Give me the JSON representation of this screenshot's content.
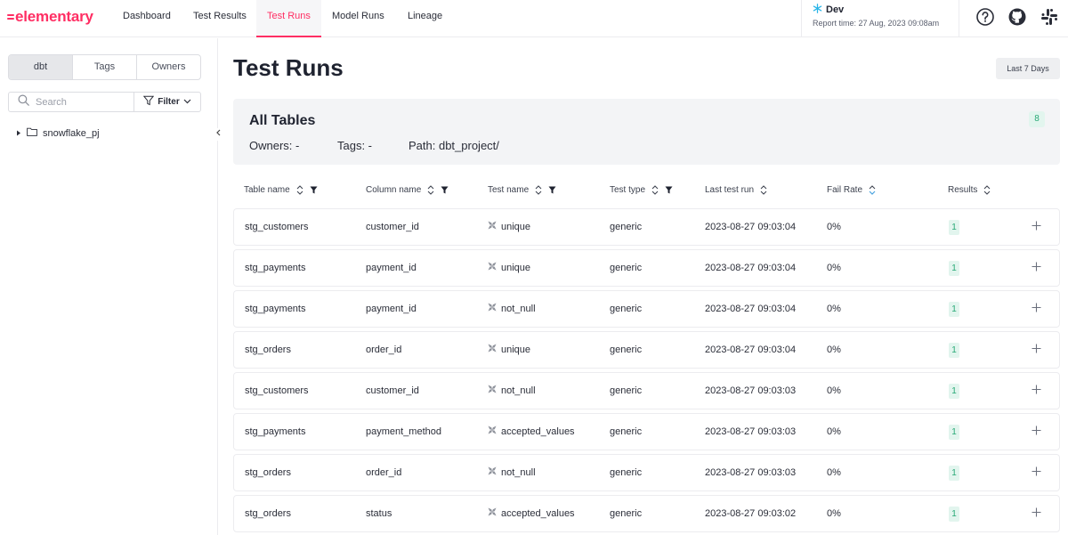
{
  "brand": {
    "name": "elementary",
    "color": "#ff2e63"
  },
  "nav": {
    "tabs": [
      {
        "label": "Dashboard"
      },
      {
        "label": "Test Results"
      },
      {
        "label": "Test Runs",
        "active": true
      },
      {
        "label": "Model Runs"
      },
      {
        "label": "Lineage"
      }
    ]
  },
  "env": {
    "icon": "snowflake-icon",
    "name": "Dev",
    "report_time": "Report time: 27 Aug, 2023 09:08am"
  },
  "header_icons": [
    "help-icon",
    "github-icon",
    "slack-icon"
  ],
  "sidebar": {
    "segments": [
      {
        "label": "dbt",
        "active": true
      },
      {
        "label": "Tags"
      },
      {
        "label": "Owners"
      }
    ],
    "search_placeholder": "Search",
    "filter_label": "Filter",
    "tree": [
      {
        "label": "snowflake_pj",
        "icon": "folder-icon",
        "expanded": false
      }
    ]
  },
  "main": {
    "title": "Test Runs",
    "range_label": "Last 7 Days",
    "summary": {
      "title": "All Tables",
      "owners": "Owners: -",
      "tags": "Tags: -",
      "path": "Path: dbt_project/",
      "count": "8"
    },
    "columns": [
      {
        "label": "Table name",
        "sortable": true,
        "filterable": true
      },
      {
        "label": "Column name",
        "sortable": true,
        "filterable": true
      },
      {
        "label": "Test name",
        "sortable": true,
        "filterable": true
      },
      {
        "label": "Test type",
        "sortable": true,
        "filterable": true
      },
      {
        "label": "Last test run",
        "sortable": true,
        "filterable": false
      },
      {
        "label": "Fail Rate",
        "sortable": true,
        "filterable": false,
        "sort_active": "desc"
      },
      {
        "label": "Results",
        "sortable": true,
        "filterable": false
      }
    ],
    "rows": [
      {
        "table": "stg_customers",
        "column": "customer_id",
        "test": "unique",
        "type": "generic",
        "last_run": "2023-08-27 09:03:04",
        "fail_rate": "0%",
        "results": "1"
      },
      {
        "table": "stg_payments",
        "column": "payment_id",
        "test": "unique",
        "type": "generic",
        "last_run": "2023-08-27 09:03:04",
        "fail_rate": "0%",
        "results": "1"
      },
      {
        "table": "stg_payments",
        "column": "payment_id",
        "test": "not_null",
        "type": "generic",
        "last_run": "2023-08-27 09:03:04",
        "fail_rate": "0%",
        "results": "1"
      },
      {
        "table": "stg_orders",
        "column": "order_id",
        "test": "unique",
        "type": "generic",
        "last_run": "2023-08-27 09:03:04",
        "fail_rate": "0%",
        "results": "1"
      },
      {
        "table": "stg_customers",
        "column": "customer_id",
        "test": "not_null",
        "type": "generic",
        "last_run": "2023-08-27 09:03:03",
        "fail_rate": "0%",
        "results": "1"
      },
      {
        "table": "stg_payments",
        "column": "payment_method",
        "test": "accepted_values",
        "type": "generic",
        "last_run": "2023-08-27 09:03:03",
        "fail_rate": "0%",
        "results": "1"
      },
      {
        "table": "stg_orders",
        "column": "order_id",
        "test": "not_null",
        "type": "generic",
        "last_run": "2023-08-27 09:03:03",
        "fail_rate": "0%",
        "results": "1"
      },
      {
        "table": "stg_orders",
        "column": "status",
        "test": "accepted_values",
        "type": "generic",
        "last_run": "2023-08-27 09:03:02",
        "fail_rate": "0%",
        "results": "1"
      }
    ],
    "colors": {
      "success_bg": "#e2f5ee",
      "success_text": "#27a875",
      "sort_active": "#4aa3df"
    }
  }
}
